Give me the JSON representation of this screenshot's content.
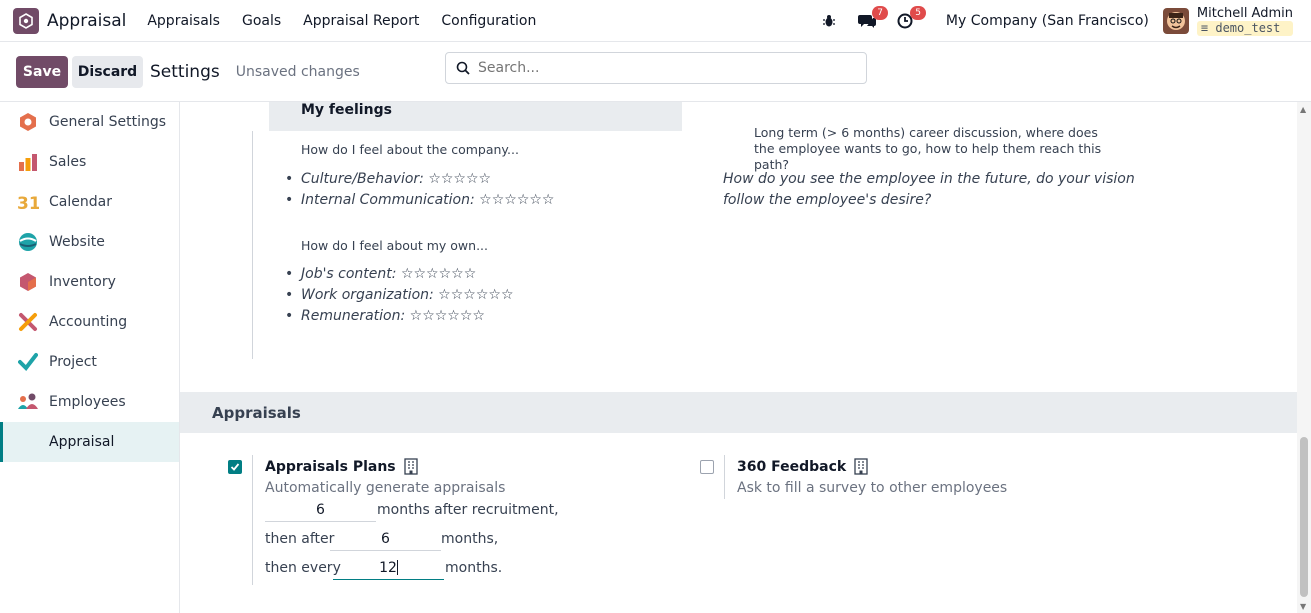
{
  "navbar": {
    "app_name": "Appraisal",
    "menu": [
      "Appraisals",
      "Goals",
      "Appraisal Report",
      "Configuration"
    ],
    "messages_count": "7",
    "activities_count": "5",
    "company": "My Company (San Francisco)",
    "user_name": "Mitchell Admin",
    "database": "demo_test"
  },
  "control": {
    "save_label": "Save",
    "discard_label": "Discard",
    "title": "Settings",
    "status": "Unsaved changes",
    "search_placeholder": "Search..."
  },
  "sidebar": {
    "items": [
      {
        "label": "General Settings",
        "icon": "general-settings-icon",
        "color": "#e46f4c"
      },
      {
        "label": "Sales",
        "icon": "sales-icon",
        "color": "#f59e0b"
      },
      {
        "label": "Calendar",
        "icon": "calendar-icon",
        "color": "#e8a93b"
      },
      {
        "label": "Website",
        "icon": "website-icon",
        "color": "#1ea3a8"
      },
      {
        "label": "Inventory",
        "icon": "inventory-icon",
        "color": "#e46f4c"
      },
      {
        "label": "Accounting",
        "icon": "accounting-icon",
        "color": "#c4576f"
      },
      {
        "label": "Project",
        "icon": "project-icon",
        "color": "#1ea3a8"
      },
      {
        "label": "Employees",
        "icon": "employees-icon",
        "color": "#714b67"
      },
      {
        "label": "Appraisal",
        "icon": "",
        "color": ""
      }
    ]
  },
  "template": {
    "feelings_heading": "My feelings",
    "company_question": "How do I feel about the company...",
    "company_items": [
      "Culture/Behavior: ☆☆☆☆☆",
      "Internal Communication: ☆☆☆☆☆☆"
    ],
    "own_question": "How do I feel about my own...",
    "own_items": [
      "Job's content: ☆☆☆☆☆☆",
      "Work organization: ☆☆☆☆☆☆",
      "Remuneration: ☆☆☆☆☆☆"
    ],
    "long_term": "Long term (> 6 months) career discussion, where does the employee wants to go, how to help them reach this path?",
    "future_question": "How do you see the employee in the future, do your vision follow the employee's desire?"
  },
  "appraisals_section": {
    "heading": "Appraisals",
    "plans": {
      "title": "Appraisals Plans",
      "description": "Automatically generate appraisals",
      "checked": true,
      "first_value": "6",
      "first_suffix": "months after recruitment,",
      "second_prefix": "then after",
      "second_value": "6",
      "second_suffix": "months,",
      "third_prefix": "then every",
      "third_value": "12",
      "third_suffix": "months."
    },
    "feedback": {
      "title": "360 Feedback",
      "description": "Ask to fill a survey to other employees",
      "checked": false
    }
  }
}
